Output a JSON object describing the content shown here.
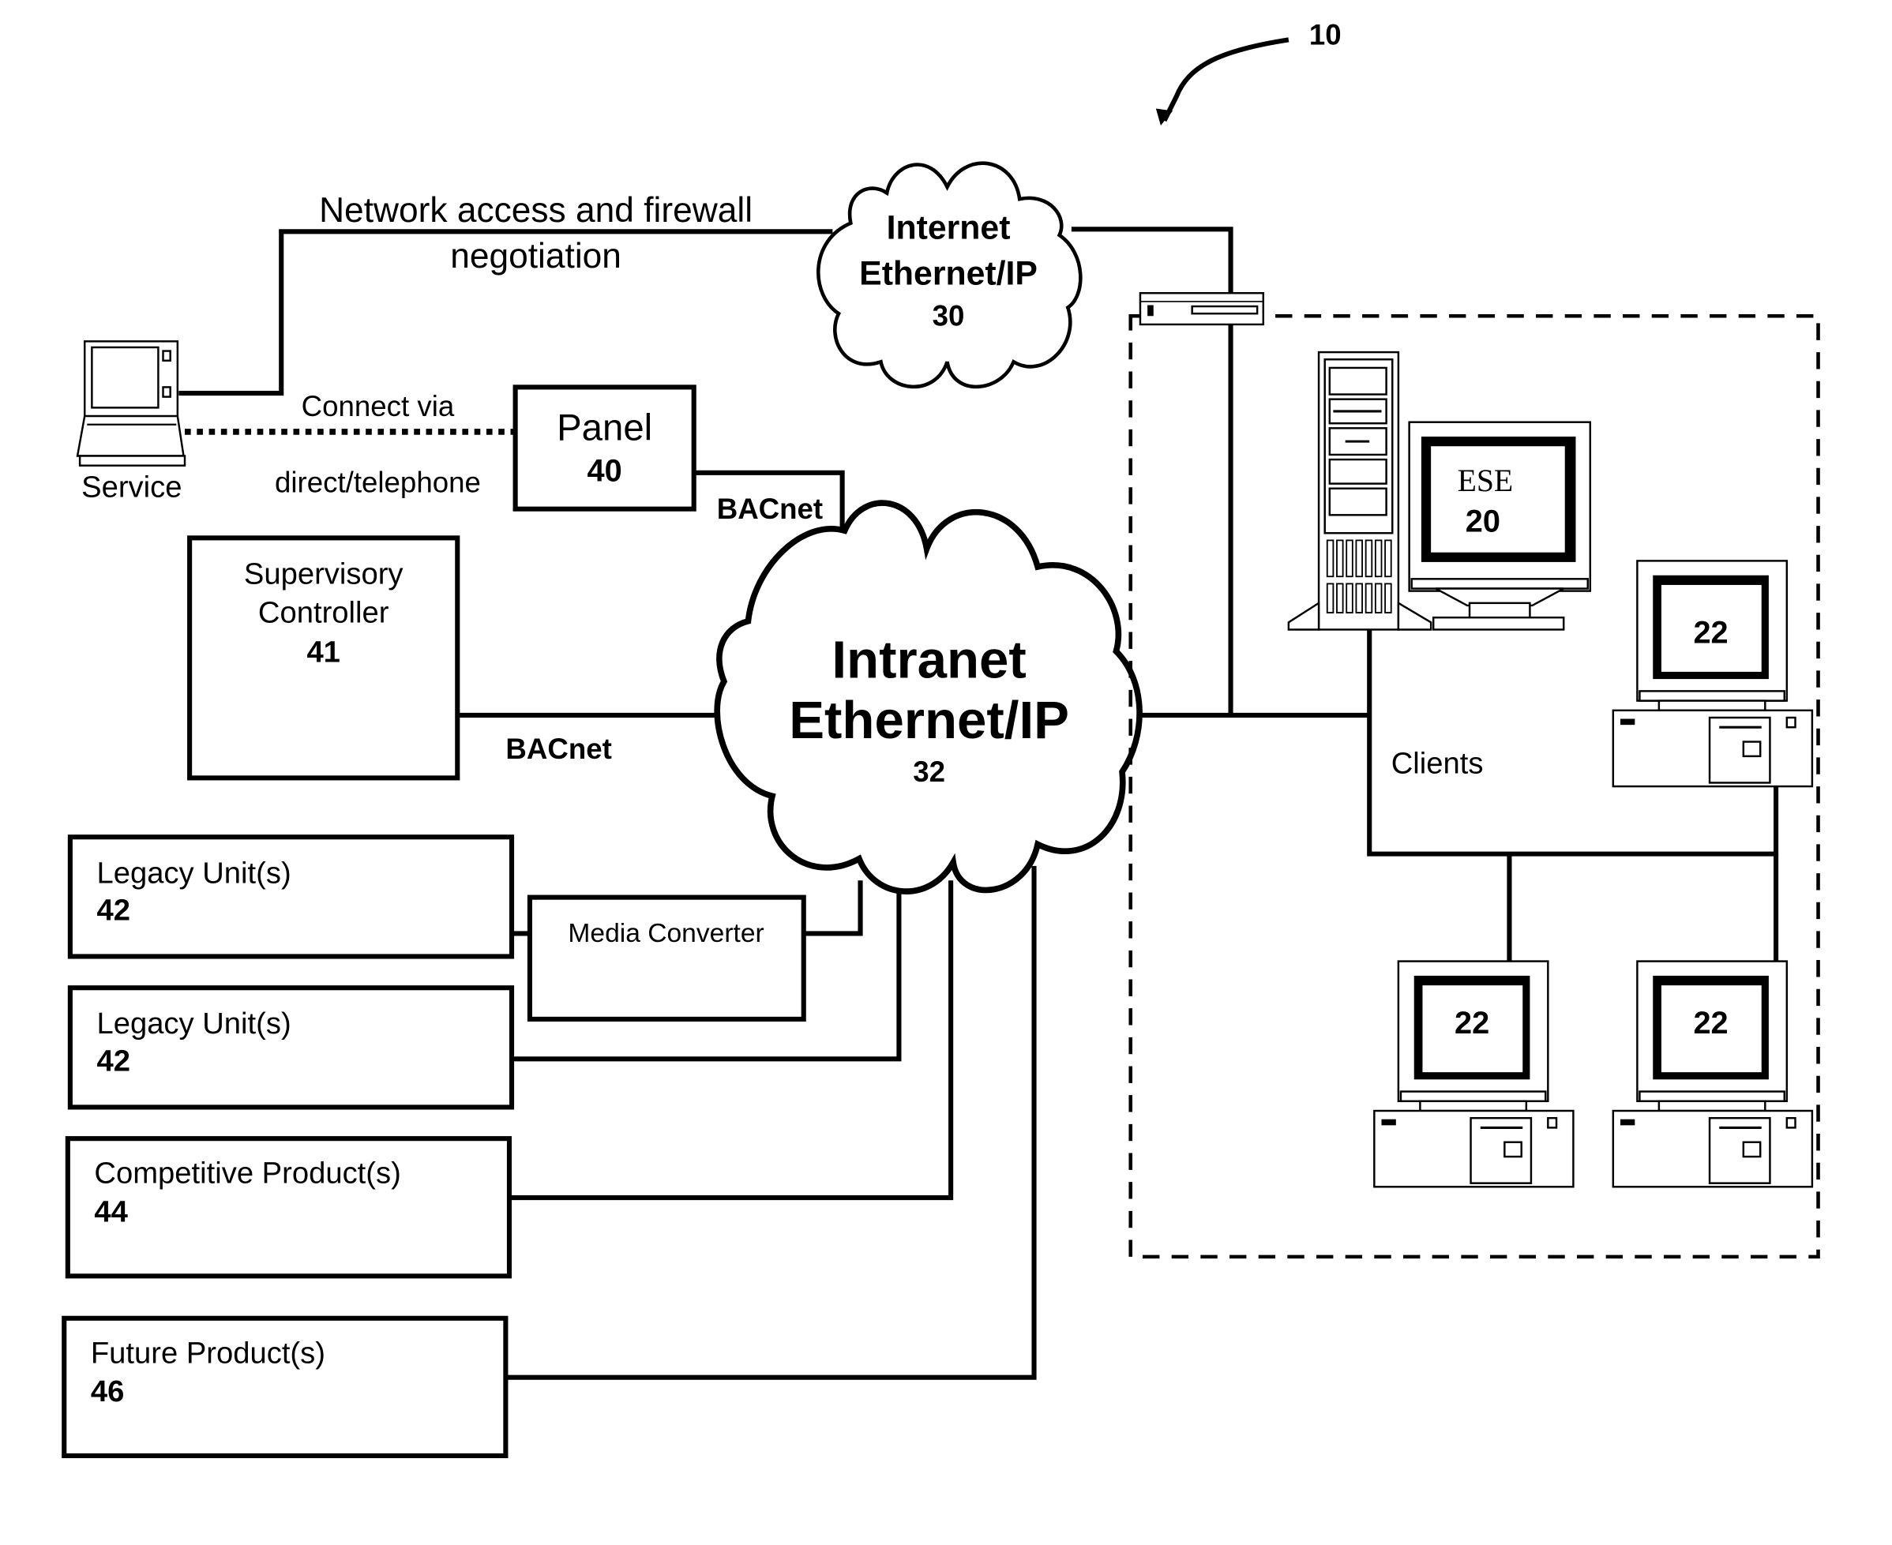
{
  "figure": {
    "reference_number": "10",
    "internet_cloud": {
      "line1": "Internet",
      "line2": "Ethernet/IP",
      "number": "30"
    },
    "intranet_cloud": {
      "line1": "Intranet",
      "line2": "Ethernet/IP",
      "number": "32"
    },
    "service": {
      "label": "Service"
    },
    "network_access_label": {
      "line1": "Network access and firewall",
      "line2": "negotiation"
    },
    "connect_label": {
      "line1": "Connect via",
      "line2": "direct/telephone"
    },
    "panel": {
      "label": "Panel",
      "number": "40"
    },
    "bacnet_panel_label": "BACnet",
    "supervisory": {
      "line1": "Supervisory",
      "line2": "Controller",
      "number": "41"
    },
    "bacnet_supervisory_label": "BACnet",
    "media_converter": {
      "label": "Media Converter"
    },
    "legacy_units": [
      {
        "label": "Legacy Unit(s)",
        "number": "42"
      },
      {
        "label": "Legacy Unit(s)",
        "number": "42"
      }
    ],
    "competitive": {
      "label": "Competitive Product(s)",
      "number": "44"
    },
    "future": {
      "label": "Future Product(s)",
      "number": "46"
    },
    "ese": {
      "label": "ESE",
      "number": "20"
    },
    "clients_label": "Clients",
    "clients": [
      {
        "number": "22"
      },
      {
        "number": "22"
      },
      {
        "number": "22"
      }
    ]
  }
}
